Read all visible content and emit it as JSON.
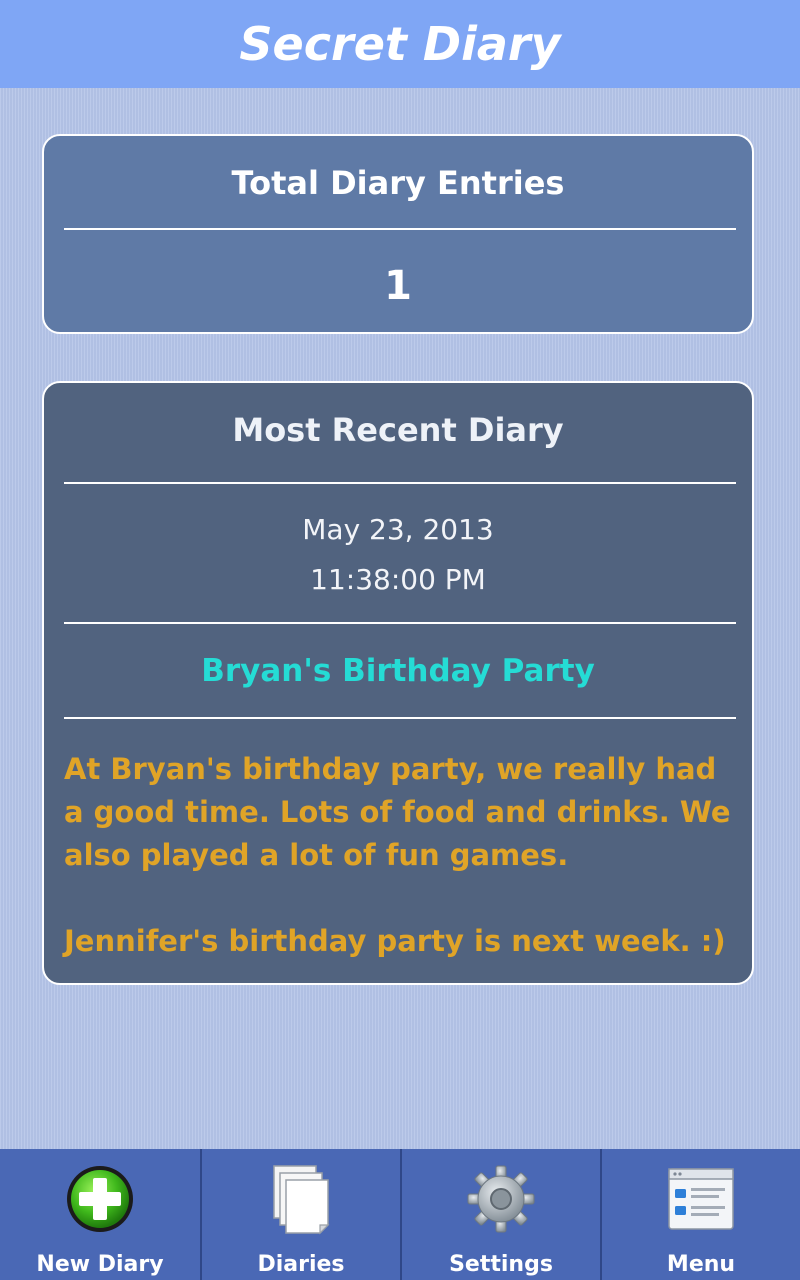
{
  "app": {
    "title": "Secret Diary"
  },
  "total_card": {
    "title": "Total Diary Entries",
    "count": "1"
  },
  "recent_card": {
    "title": "Most Recent Diary",
    "date": "May 23, 2013",
    "time": "11:38:00 PM",
    "entry_title": "Bryan's Birthday Party",
    "entry_body_paragraph_1": "At Bryan's birthday party, we really had a good time. Lots of food and drinks. We also played a lot of fun games.",
    "entry_body_paragraph_2": "Jennifer's birthday party is next week. :)"
  },
  "bottom_nav": {
    "items": [
      {
        "label": "New Diary",
        "icon": "plus-circle-icon"
      },
      {
        "label": "Diaries",
        "icon": "pages-icon"
      },
      {
        "label": "Settings",
        "icon": "gear-icon"
      },
      {
        "label": "Menu",
        "icon": "menu-list-icon"
      }
    ]
  },
  "colors": {
    "header": "#7fa6f5",
    "background": "#b4c4e8",
    "total_card": "#5f7aa6",
    "recent_card": "#51637f",
    "entry_title": "#25dcd5",
    "entry_body": "#e0a427",
    "bottom_bar": "#4a68b5"
  }
}
